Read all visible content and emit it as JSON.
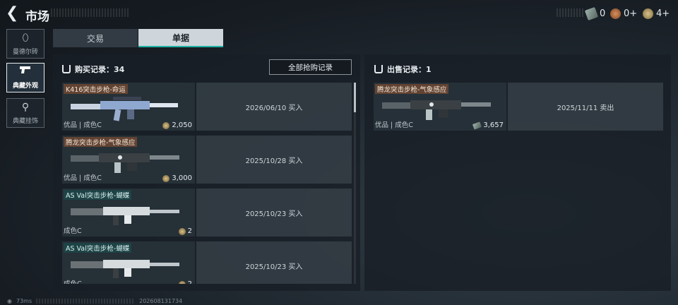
{
  "header": {
    "title": "市场",
    "currencies": [
      {
        "icon": "voucher-icon",
        "value": "0"
      },
      {
        "icon": "coin-bronze-icon",
        "value": "0+"
      },
      {
        "icon": "coin-gold-icon",
        "value": "4+"
      }
    ]
  },
  "sidebar": {
    "items": [
      {
        "label": "曼德尔砖",
        "icon": "brick-icon",
        "active": false
      },
      {
        "label": "典藏外观",
        "icon": "pistol-icon",
        "active": true
      },
      {
        "label": "典藏挂饰",
        "icon": "charm-icon",
        "active": false
      }
    ]
  },
  "tabs": [
    {
      "label": "交易",
      "active": false
    },
    {
      "label": "单据",
      "active": true
    }
  ],
  "buy": {
    "title": "购买记录：34",
    "all_button": "全部抢购记录",
    "records": [
      {
        "name": "K416突击步枪-命运",
        "grade": "优品 | 成色C",
        "price": "2,050",
        "date": "2026/06/10 买入",
        "name_style": "brown"
      },
      {
        "name": "腾龙突击步枪-气象感应",
        "grade": "优品 | 成色C",
        "price": "3,000",
        "date": "2025/10/28 买入",
        "name_style": "brown"
      },
      {
        "name": "AS Val突击步枪-蝴蝶",
        "grade": "成色C",
        "price": "2",
        "date": "2025/10/23 买入",
        "name_style": "teal"
      },
      {
        "name": "AS Val突击步枪-蝴蝶",
        "grade": "成色C",
        "price": "2",
        "date": "2025/10/23 买入",
        "name_style": "teal"
      }
    ]
  },
  "sell": {
    "title": "出售记录：1",
    "records": [
      {
        "name": "腾龙突击步枪-气象感应",
        "grade": "优品 | 成色C",
        "price": "3,657",
        "date": "2025/11/11 卖出"
      }
    ]
  },
  "footer": {
    "ping": "73ms",
    "build": "202608131734"
  },
  "colors": {
    "accent_teal": "#1fb3a5",
    "active_tab_bg": "#cfd6db",
    "brown_label": "#6e4632"
  }
}
